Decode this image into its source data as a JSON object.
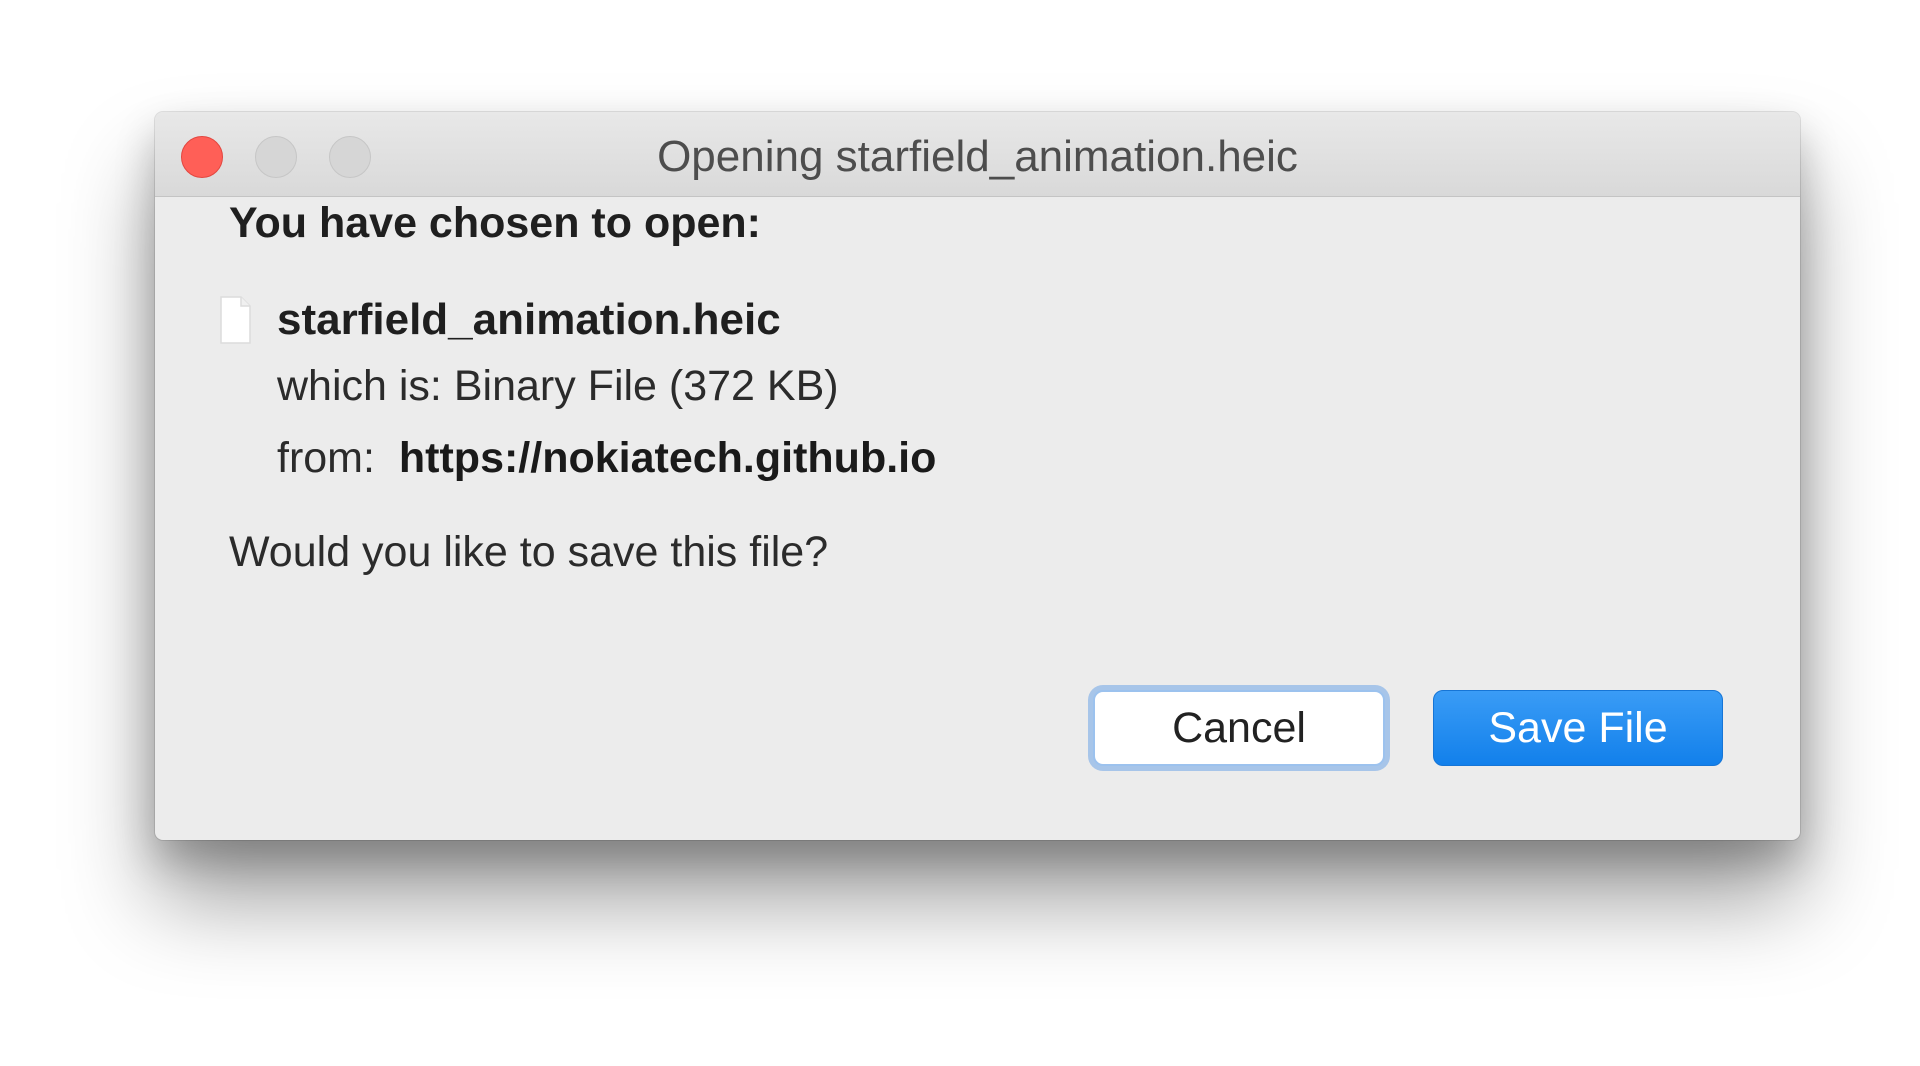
{
  "window": {
    "title": "Opening starfield_animation.heic"
  },
  "dialog": {
    "heading": "You have chosen to open:",
    "file_name": "starfield_animation.heic",
    "which_is_label": "which is:",
    "which_is_value": "Binary File (372 KB)",
    "from_label": "from:",
    "from_value": "https://nokiatech.github.io",
    "question": "Would you like to save this file?"
  },
  "buttons": {
    "cancel_label": "Cancel",
    "save_label": "Save File"
  },
  "colors": {
    "close": "#ff5f57",
    "primary_button": "#1a86f0",
    "focus_ring": "#5496e6"
  },
  "icons": {
    "file": "document-icon"
  }
}
